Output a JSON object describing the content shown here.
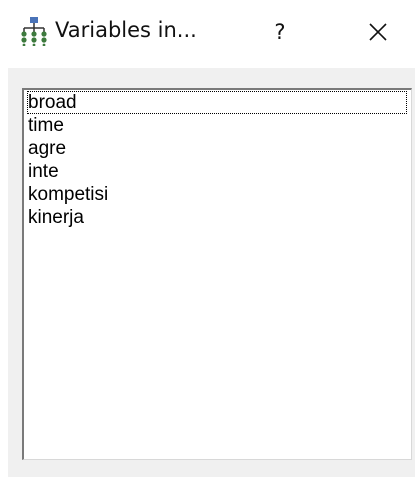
{
  "window": {
    "title": "Variables in...",
    "help_label": "?",
    "icon": "network-tree-icon",
    "close_icon": "close-icon"
  },
  "variables": {
    "items": [
      {
        "label": "broad",
        "focused": true
      },
      {
        "label": "time",
        "focused": false
      },
      {
        "label": "agre",
        "focused": false
      },
      {
        "label": "inte",
        "focused": false
      },
      {
        "label": "kompetisi",
        "focused": false
      },
      {
        "label": "kinerja",
        "focused": false
      }
    ]
  },
  "colors": {
    "icon_top": "#4a73b8",
    "icon_nodes": "#3d7a3d"
  }
}
